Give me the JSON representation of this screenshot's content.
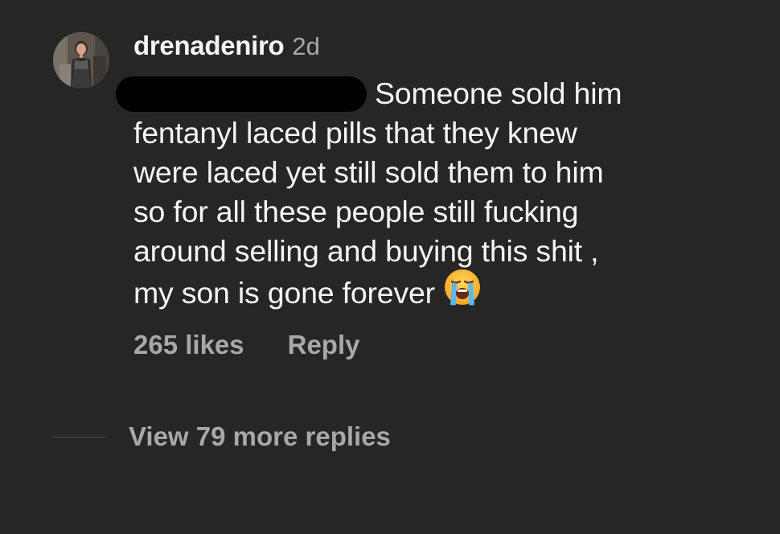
{
  "comment": {
    "username": "drenadeniro",
    "time_ago": "2d",
    "text_lines": [
      "Someone sold him",
      "fentanyl laced pills that they knew",
      "were laced yet still sold them to him",
      "so for all these people still fucking",
      "around selling and buying this shit ,",
      "my son is gone forever"
    ],
    "emoji": "loudly-crying-face",
    "likes_label": "265 likes",
    "reply_label": "Reply"
  },
  "thread": {
    "view_replies_label": "View 79 more replies"
  },
  "colors": {
    "background": "#262626",
    "primary_text": "#f5f5f5",
    "secondary_text": "#a8a8a8",
    "redaction": "#000000"
  }
}
